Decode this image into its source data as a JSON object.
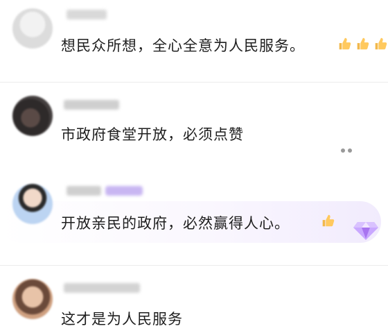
{
  "comments": [
    {
      "text": "想民众所想，全心全意为人民服务。",
      "reaction": "thumbs-up",
      "reaction_count": 3
    },
    {
      "text": "市政府食堂开放，必须点赞"
    },
    {
      "text": "开放亲民的政府，必然赢得人心。",
      "reaction": "thumbs-up",
      "reaction_count": 1
    },
    {
      "text": "这才是为人民服务"
    }
  ],
  "colors": {
    "text": "#1e1e1e",
    "username_placeholder": "#d9d9d9",
    "badge": "#c8b6f2",
    "highlight": "#f1ebfd",
    "gem": "#a874f0"
  }
}
